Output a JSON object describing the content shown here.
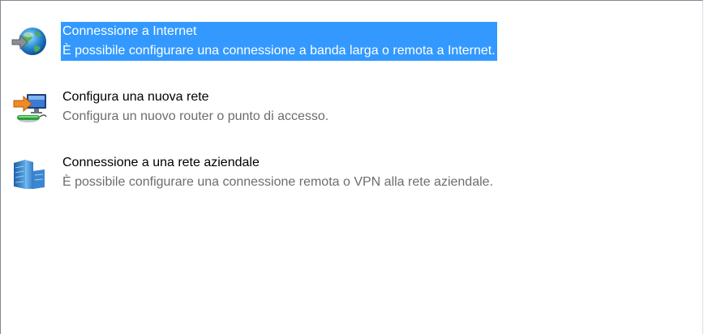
{
  "options": [
    {
      "title": "Connessione a Internet",
      "description": "È possibile configurare una connessione a banda larga o remota a Internet.",
      "icon": "internet-globe-icon",
      "selected": true
    },
    {
      "title": "Configura una nuova rete",
      "description": "Configura un nuovo router o punto di accesso.",
      "icon": "new-network-router-icon",
      "selected": false
    },
    {
      "title": "Connessione a una rete aziendale",
      "description": "È possibile configurare una connessione remota o VPN alla rete aziendale.",
      "icon": "workplace-building-icon",
      "selected": false
    }
  ],
  "colors": {
    "selection": "#3399ff",
    "description_text": "#6d6d6d"
  }
}
